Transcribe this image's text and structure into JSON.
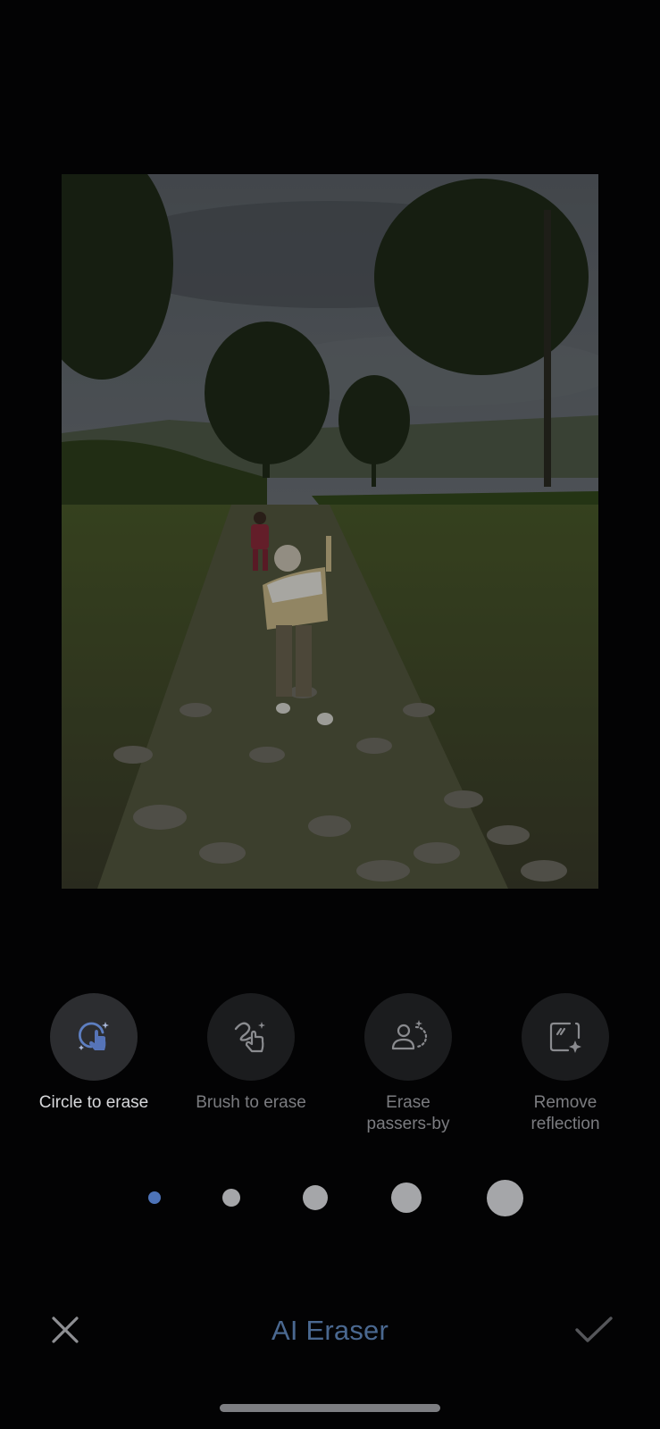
{
  "photo": {
    "alt": "Children walking on a stone path"
  },
  "tools": [
    {
      "label": "Circle to erase",
      "icon": "circle-to-erase-icon",
      "active": true
    },
    {
      "label": "Brush to erase",
      "icon": "brush-to-erase-icon",
      "active": false
    },
    {
      "label": "Erase\npassers-by",
      "icon": "erase-passers-by-icon",
      "active": false
    },
    {
      "label": "Remove\nreflection",
      "icon": "remove-reflection-icon",
      "active": false
    }
  ],
  "brush_sizes": {
    "count": 5,
    "selected_index": 0
  },
  "bottom_bar": {
    "title": "AI Eraser",
    "close_icon": "close-icon",
    "confirm_icon": "checkmark-icon"
  },
  "colors": {
    "accent": "#4d73b8",
    "title": "#4a6890",
    "background": "#030304"
  }
}
